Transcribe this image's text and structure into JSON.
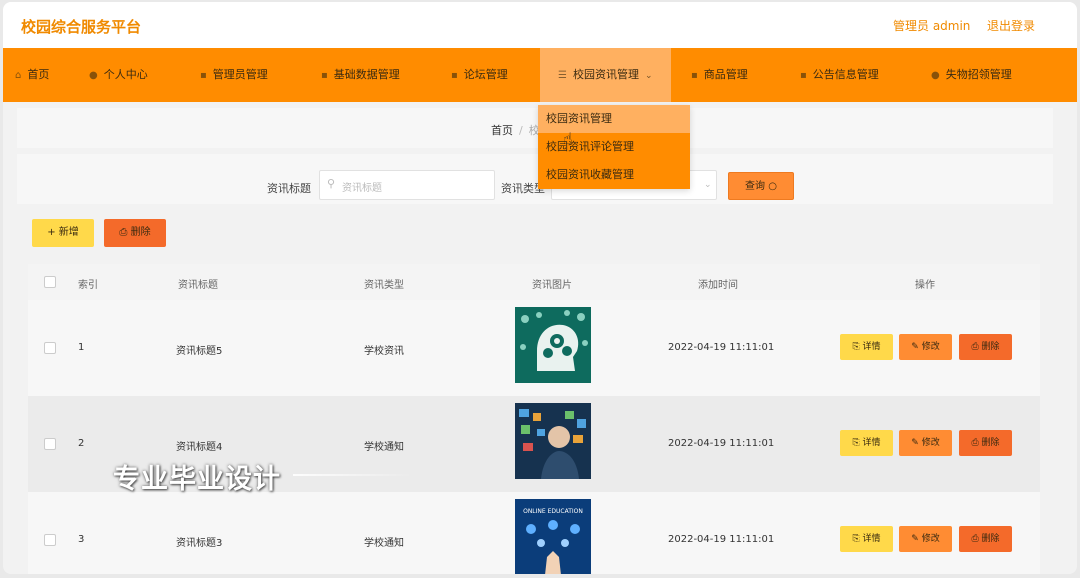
{
  "header": {
    "brand": "校园综合服务平台",
    "admin_label": "管理员 admin",
    "logout": "退出登录",
    "accent_color": "#ff8c00"
  },
  "nav": {
    "items": [
      {
        "label": "首页",
        "icon": "home-icon"
      },
      {
        "label": "个人中心",
        "icon": "user-icon"
      },
      {
        "label": "管理员管理",
        "icon": "admin-icon"
      },
      {
        "label": "基础数据管理",
        "icon": "data-icon"
      },
      {
        "label": "论坛管理",
        "icon": "forum-icon"
      },
      {
        "label": "校园资讯管理",
        "icon": "menu-icon",
        "active": true
      },
      {
        "label": "商品管理",
        "icon": "goods-icon"
      },
      {
        "label": "公告信息管理",
        "icon": "notice-icon"
      },
      {
        "label": "失物招领管理",
        "icon": "lost-found-icon"
      }
    ],
    "dropdown": [
      {
        "label": "校园资讯管理"
      },
      {
        "label": "校园资讯评论管理"
      },
      {
        "label": "校园资讯收藏管理"
      }
    ]
  },
  "breadcrumb": {
    "home": "首页",
    "sep": "/",
    "current": "校"
  },
  "search": {
    "title_label": "资讯标题",
    "title_placeholder": "资讯标题",
    "type_label": "资讯类型",
    "query_button": "查询 ○"
  },
  "actions": {
    "add": "+ 新增",
    "delete": "⎙ 删除"
  },
  "table": {
    "headers": {
      "index": "索引",
      "title": "资讯标题",
      "type": "资讯类型",
      "image": "资讯图片",
      "time": "添加时间",
      "ops": "操作"
    },
    "rows": [
      {
        "index": "1",
        "title": "资讯标题5",
        "type": "学校资讯",
        "time": "2022-04-19 11:11:01",
        "image": "brain-gears-image"
      },
      {
        "index": "2",
        "title": "资讯标题4",
        "type": "学校通知",
        "time": "2022-04-19 11:11:01",
        "image": "tech-person-image"
      },
      {
        "index": "3",
        "title": "资讯标题3",
        "type": "学校通知",
        "time": "2022-04-19 11:11:01",
        "image": "online-education-image"
      }
    ],
    "op_labels": {
      "detail": "⎘ 详情",
      "edit": "✎ 修改",
      "remove": "⎙ 删除"
    },
    "thumb_text": "ONLINE EDUCATION"
  },
  "watermark": "专业毕业设计"
}
